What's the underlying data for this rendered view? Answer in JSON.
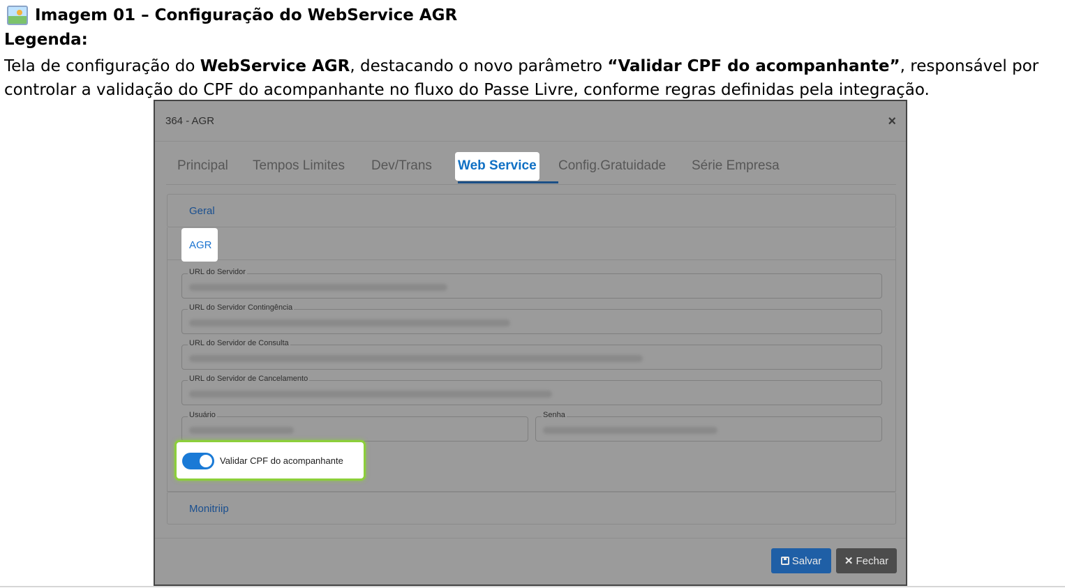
{
  "document": {
    "title": "Imagem 01 – Configuração do WebService AGR",
    "legend_label": "Legenda:",
    "caption": {
      "part1": "Tela de configuração do ",
      "bold1": "WebService AGR",
      "part2": ", destacando o novo parâmetro ",
      "bold2": "“Validar CPF do acompanhante”",
      "part3": ", responsável por controlar a validação do CPF do acompanhante no fluxo do Passe Livre, conforme regras definidas pela integração."
    }
  },
  "modal": {
    "title": "364 - AGR",
    "close_symbol": "×",
    "tabs": [
      "Principal",
      "Tempos Limites",
      "Dev/Trans",
      "Web Service",
      "Config.Gratuidade",
      "Série Empresa"
    ],
    "active_tab": "Web Service",
    "panels": {
      "geral": "Geral",
      "agr": "AGR",
      "monitriip": "Monitriip"
    },
    "fields": {
      "url_servidor": "URL do Servidor",
      "url_contingencia": "URL do Servidor Contingência",
      "url_consulta": "URL do Servidor de Consulta",
      "url_cancelamento": "URL do Servidor de Cancelamento",
      "usuario": "Usuário",
      "senha": "Senha"
    },
    "toggle": {
      "label": "Validar CPF do acompanhante",
      "checked": true
    },
    "buttons": {
      "save": "Salvar",
      "close": "Fechar",
      "close_symbol": "✕"
    }
  },
  "colors": {
    "accent": "#1a7ad6",
    "highlight_border": "#8ccf3a",
    "save_button": "#1f5fa6",
    "close_button": "#4c4c4c"
  }
}
